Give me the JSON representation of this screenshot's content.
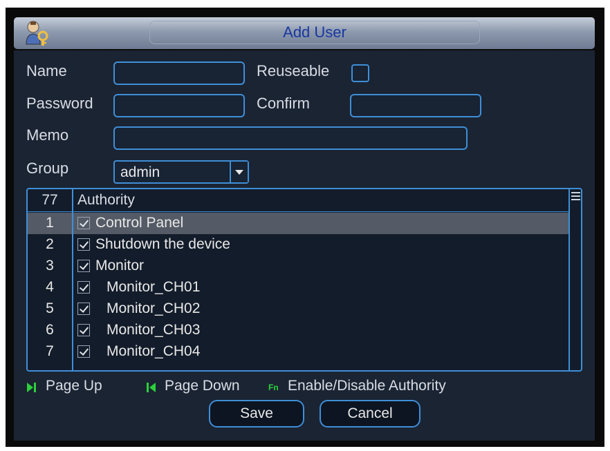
{
  "window": {
    "title": "Add User",
    "icon": "users-key-icon"
  },
  "form": {
    "name_label": "Name",
    "name_value": "",
    "reuseable_label": "Reuseable",
    "reuseable_checked": false,
    "password_label": "Password",
    "password_value": "",
    "confirm_label": "Confirm",
    "confirm_value": "",
    "memo_label": "Memo",
    "memo_value": "",
    "group_label": "Group",
    "group_value": "admin"
  },
  "authority": {
    "count": "77",
    "header": "Authority",
    "rows": [
      {
        "num": "1",
        "name": "Control Panel",
        "checked": true,
        "selected": true
      },
      {
        "num": "2",
        "name": "Shutdown the device",
        "checked": true
      },
      {
        "num": "3",
        "name": "Monitor",
        "checked": true
      },
      {
        "num": "4",
        "name": "Monitor_CH01",
        "checked": true
      },
      {
        "num": "5",
        "name": "Monitor_CH02",
        "checked": true
      },
      {
        "num": "6",
        "name": "Monitor_CH03",
        "checked": true
      },
      {
        "num": "7",
        "name": "Monitor_CH04",
        "checked": true
      }
    ]
  },
  "hints": {
    "page_up": "Page Up",
    "page_down": "Page Down",
    "fn_key": "Fn",
    "enable_disable": "Enable/Disable Authority"
  },
  "buttons": {
    "save": "Save",
    "cancel": "Cancel"
  },
  "colors": {
    "accent": "#3f8fd8",
    "title_text": "#1838a0",
    "panel_bg": "#1b2433",
    "selected_row": "#555b66",
    "hint_icon": "#2bd13a"
  }
}
